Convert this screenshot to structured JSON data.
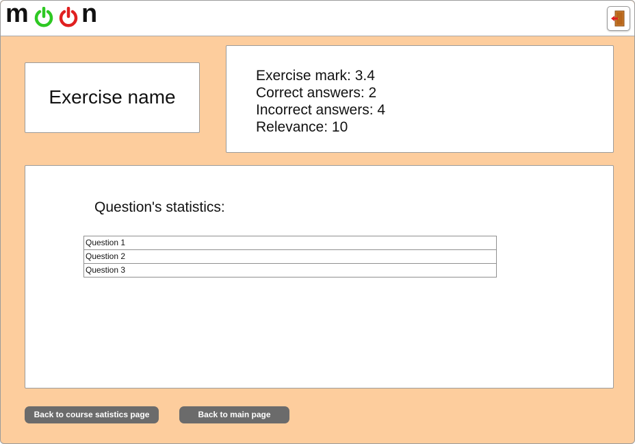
{
  "app": {
    "logo_letters": [
      "m",
      "n"
    ],
    "power_colors": [
      "#2ec823",
      "#e02020"
    ]
  },
  "header": {
    "exit_icon": "exit-door-icon"
  },
  "exercise": {
    "name": "Exercise name",
    "details": [
      "Exercise mark:  3.4",
      "Correct answers: 2",
      "Incorrect answers: 4",
      "Relevance: 10"
    ]
  },
  "statistics": {
    "title": "Question's statistics:",
    "rows": [
      "Question 1",
      "Question 2",
      "Question 3"
    ]
  },
  "actions": {
    "back_course": "Back to course satistics page",
    "back_main": "Back to main page"
  },
  "colors": {
    "background": "#fdcd9d",
    "button": "#6b6b6b"
  }
}
